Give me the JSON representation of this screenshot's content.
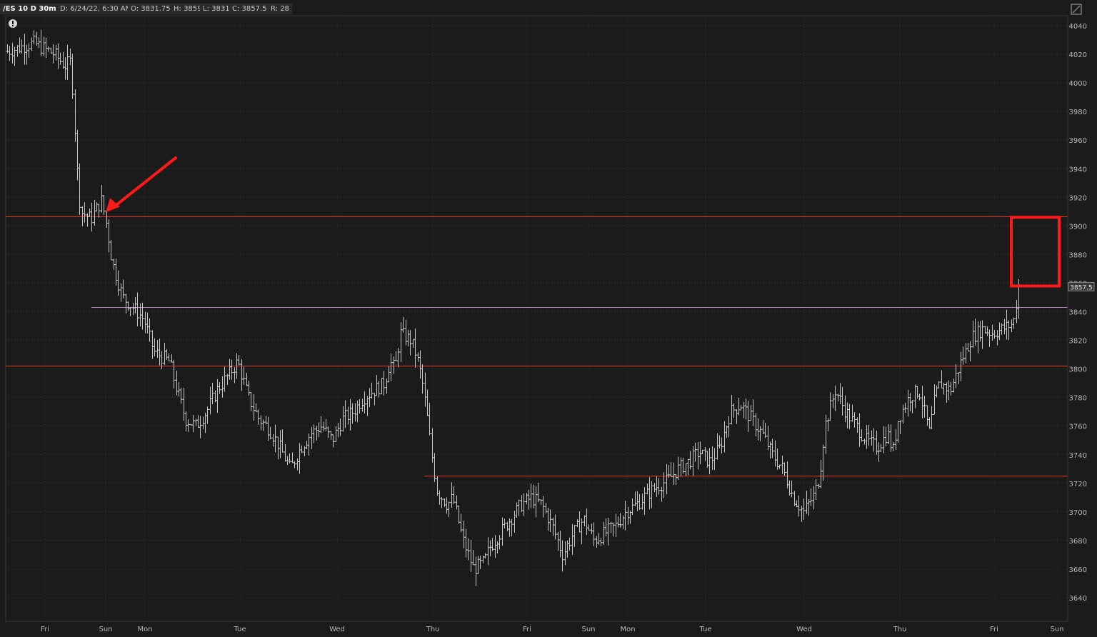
{
  "header": {
    "symbol": "/ES 10 D 30m",
    "date": "D: 6/24/22, 6:30 AM",
    "open": "O: 3831.75",
    "high": "H: 3859",
    "low": "L: 3831",
    "close": "C: 3857.5",
    "range": "R: 28"
  },
  "colors": {
    "background": "#1b1b1b",
    "grid": "#3a3a3a",
    "bars": "#c8c8c8",
    "support_resistance": "#e03a2a",
    "purple_line": "#c080c8",
    "annotation": "#ff1a1a"
  },
  "icons": [
    "alert-icon",
    "expand-icon",
    "arrow-annotation",
    "box-annotation"
  ],
  "chart_data": {
    "type": "ohlc-bar",
    "price_axis": {
      "ylim": [
        3630,
        4045
      ],
      "ticks": [
        4040,
        4020,
        4000,
        3980,
        3960,
        3940,
        3920,
        3900,
        3880,
        3860,
        3840,
        3820,
        3800,
        3780,
        3760,
        3740,
        3720,
        3700,
        3680,
        3660,
        3640
      ],
      "last_price_label": "3857.5",
      "last_price": 3857.5
    },
    "time_axis": {
      "labels": [
        "Fri",
        "Sun",
        "Mon",
        "Tue",
        "Wed",
        "Thu",
        "Fri",
        "Sun",
        "Mon",
        "Tue",
        "Wed",
        "Thu",
        "Fri",
        "Sun"
      ]
    },
    "horizontal_lines": [
      {
        "price": 3906.5,
        "color": "red"
      },
      {
        "price": 3843,
        "color": "purple"
      },
      {
        "price": 3802,
        "color": "red"
      },
      {
        "price": 3725,
        "color": "red"
      }
    ],
    "price_path": [
      [
        0.0,
        4022
      ],
      [
        0.025,
        4028
      ],
      [
        0.045,
        4020
      ],
      [
        0.055,
        4012
      ],
      [
        0.06,
        4015
      ],
      [
        0.063,
        3990
      ],
      [
        0.066,
        3945
      ],
      [
        0.07,
        3910
      ],
      [
        0.08,
        3905
      ],
      [
        0.09,
        3918
      ],
      [
        0.095,
        3900
      ],
      [
        0.1,
        3875
      ],
      [
        0.11,
        3850
      ],
      [
        0.12,
        3843
      ],
      [
        0.13,
        3835
      ],
      [
        0.14,
        3812
      ],
      [
        0.155,
        3805
      ],
      [
        0.16,
        3790
      ],
      [
        0.17,
        3765
      ],
      [
        0.18,
        3760
      ],
      [
        0.19,
        3770
      ],
      [
        0.2,
        3785
      ],
      [
        0.21,
        3795
      ],
      [
        0.22,
        3805
      ],
      [
        0.23,
        3780
      ],
      [
        0.24,
        3765
      ],
      [
        0.25,
        3758
      ],
      [
        0.26,
        3745
      ],
      [
        0.27,
        3730
      ],
      [
        0.28,
        3745
      ],
      [
        0.29,
        3755
      ],
      [
        0.3,
        3760
      ],
      [
        0.31,
        3750
      ],
      [
        0.32,
        3765
      ],
      [
        0.33,
        3770
      ],
      [
        0.34,
        3780
      ],
      [
        0.35,
        3785
      ],
      [
        0.36,
        3790
      ],
      [
        0.365,
        3805
      ],
      [
        0.37,
        3800
      ],
      [
        0.375,
        3825
      ],
      [
        0.385,
        3820
      ],
      [
        0.39,
        3810
      ],
      [
        0.395,
        3795
      ],
      [
        0.4,
        3770
      ],
      [
        0.405,
        3740
      ],
      [
        0.41,
        3715
      ],
      [
        0.42,
        3705
      ],
      [
        0.425,
        3710
      ],
      [
        0.43,
        3695
      ],
      [
        0.435,
        3680
      ],
      [
        0.445,
        3660
      ],
      [
        0.455,
        3665
      ],
      [
        0.46,
        3675
      ],
      [
        0.47,
        3685
      ],
      [
        0.48,
        3695
      ],
      [
        0.49,
        3705
      ],
      [
        0.5,
        3710
      ],
      [
        0.51,
        3705
      ],
      [
        0.52,
        3690
      ],
      [
        0.53,
        3670
      ],
      [
        0.54,
        3685
      ],
      [
        0.55,
        3695
      ],
      [
        0.56,
        3680
      ],
      [
        0.57,
        3685
      ],
      [
        0.58,
        3690
      ],
      [
        0.59,
        3700
      ],
      [
        0.6,
        3705
      ],
      [
        0.61,
        3712
      ],
      [
        0.62,
        3718
      ],
      [
        0.63,
        3722
      ],
      [
        0.64,
        3730
      ],
      [
        0.65,
        3735
      ],
      [
        0.66,
        3742
      ],
      [
        0.67,
        3735
      ],
      [
        0.68,
        3745
      ],
      [
        0.69,
        3770
      ],
      [
        0.7,
        3775
      ],
      [
        0.71,
        3765
      ],
      [
        0.72,
        3755
      ],
      [
        0.73,
        3740
      ],
      [
        0.74,
        3730
      ],
      [
        0.75,
        3710
      ],
      [
        0.76,
        3700
      ],
      [
        0.77,
        3712
      ],
      [
        0.775,
        3725
      ],
      [
        0.78,
        3760
      ],
      [
        0.79,
        3785
      ],
      [
        0.8,
        3770
      ],
      [
        0.81,
        3760
      ],
      [
        0.82,
        3750
      ],
      [
        0.83,
        3745
      ],
      [
        0.84,
        3755
      ],
      [
        0.845,
        3742
      ],
      [
        0.85,
        3765
      ],
      [
        0.86,
        3780
      ],
      [
        0.87,
        3785
      ],
      [
        0.875,
        3770
      ],
      [
        0.88,
        3755
      ],
      [
        0.885,
        3780
      ],
      [
        0.89,
        3790
      ],
      [
        0.9,
        3785
      ],
      [
        0.91,
        3805
      ],
      [
        0.92,
        3822
      ],
      [
        0.93,
        3828
      ],
      [
        0.94,
        3825
      ],
      [
        0.95,
        3828
      ],
      [
        0.955,
        3830
      ],
      [
        0.96,
        3832
      ],
      [
        0.965,
        3857.5
      ]
    ],
    "bar_count": 420,
    "annotations": [
      {
        "type": "arrow",
        "color": "red",
        "points_to_price": 3906.5
      },
      {
        "type": "rectangle",
        "color": "red",
        "price_range": [
          3860,
          3906
        ]
      }
    ]
  }
}
